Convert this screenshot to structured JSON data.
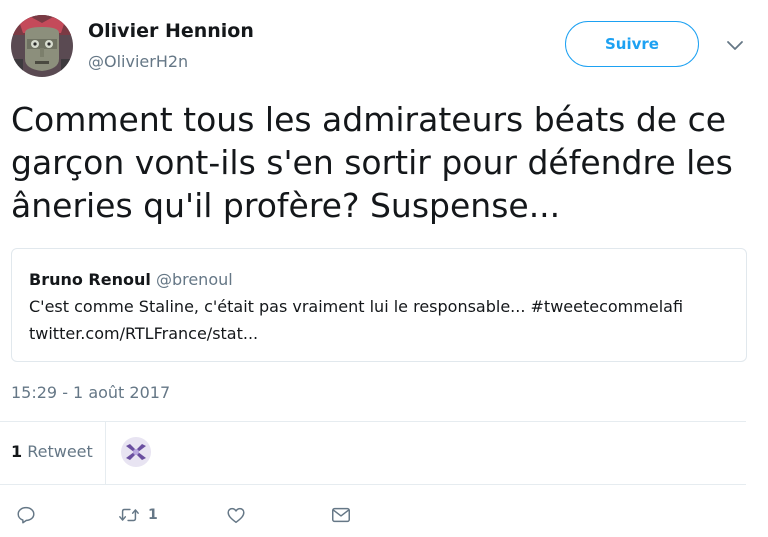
{
  "author": {
    "name": "Olivier Hennion",
    "handle": "@OlivierH2n"
  },
  "follow_button": {
    "label": "Suivre"
  },
  "tweet": {
    "lines": [
      "Comment tous les admirateurs béats de ce",
      "garçon vont-ils s'en sortir pour défendre les",
      "âneries qu'il profère? Suspense..."
    ]
  },
  "quoted_tweet": {
    "author_name": "Bruno Renoul",
    "author_handle": "@brenoul",
    "line1": "C'est comme Staline, c'était pas vraiment lui le responsable... #tweetecommelafi",
    "line2": "twitter.com/RTLFrance/stat..."
  },
  "timestamp": "15:29 - 1 août 2017",
  "stats": {
    "retweet_count": "1",
    "retweet_label": "Retweet"
  },
  "actions": {
    "retweet_count": "1"
  },
  "colors": {
    "accent": "#1da1f2",
    "secondary_text": "#657786",
    "border": "#e1e8ed"
  },
  "icons": [
    "reply-icon",
    "retweet-icon",
    "like-icon",
    "direct-message-icon",
    "chevron-down-icon"
  ]
}
